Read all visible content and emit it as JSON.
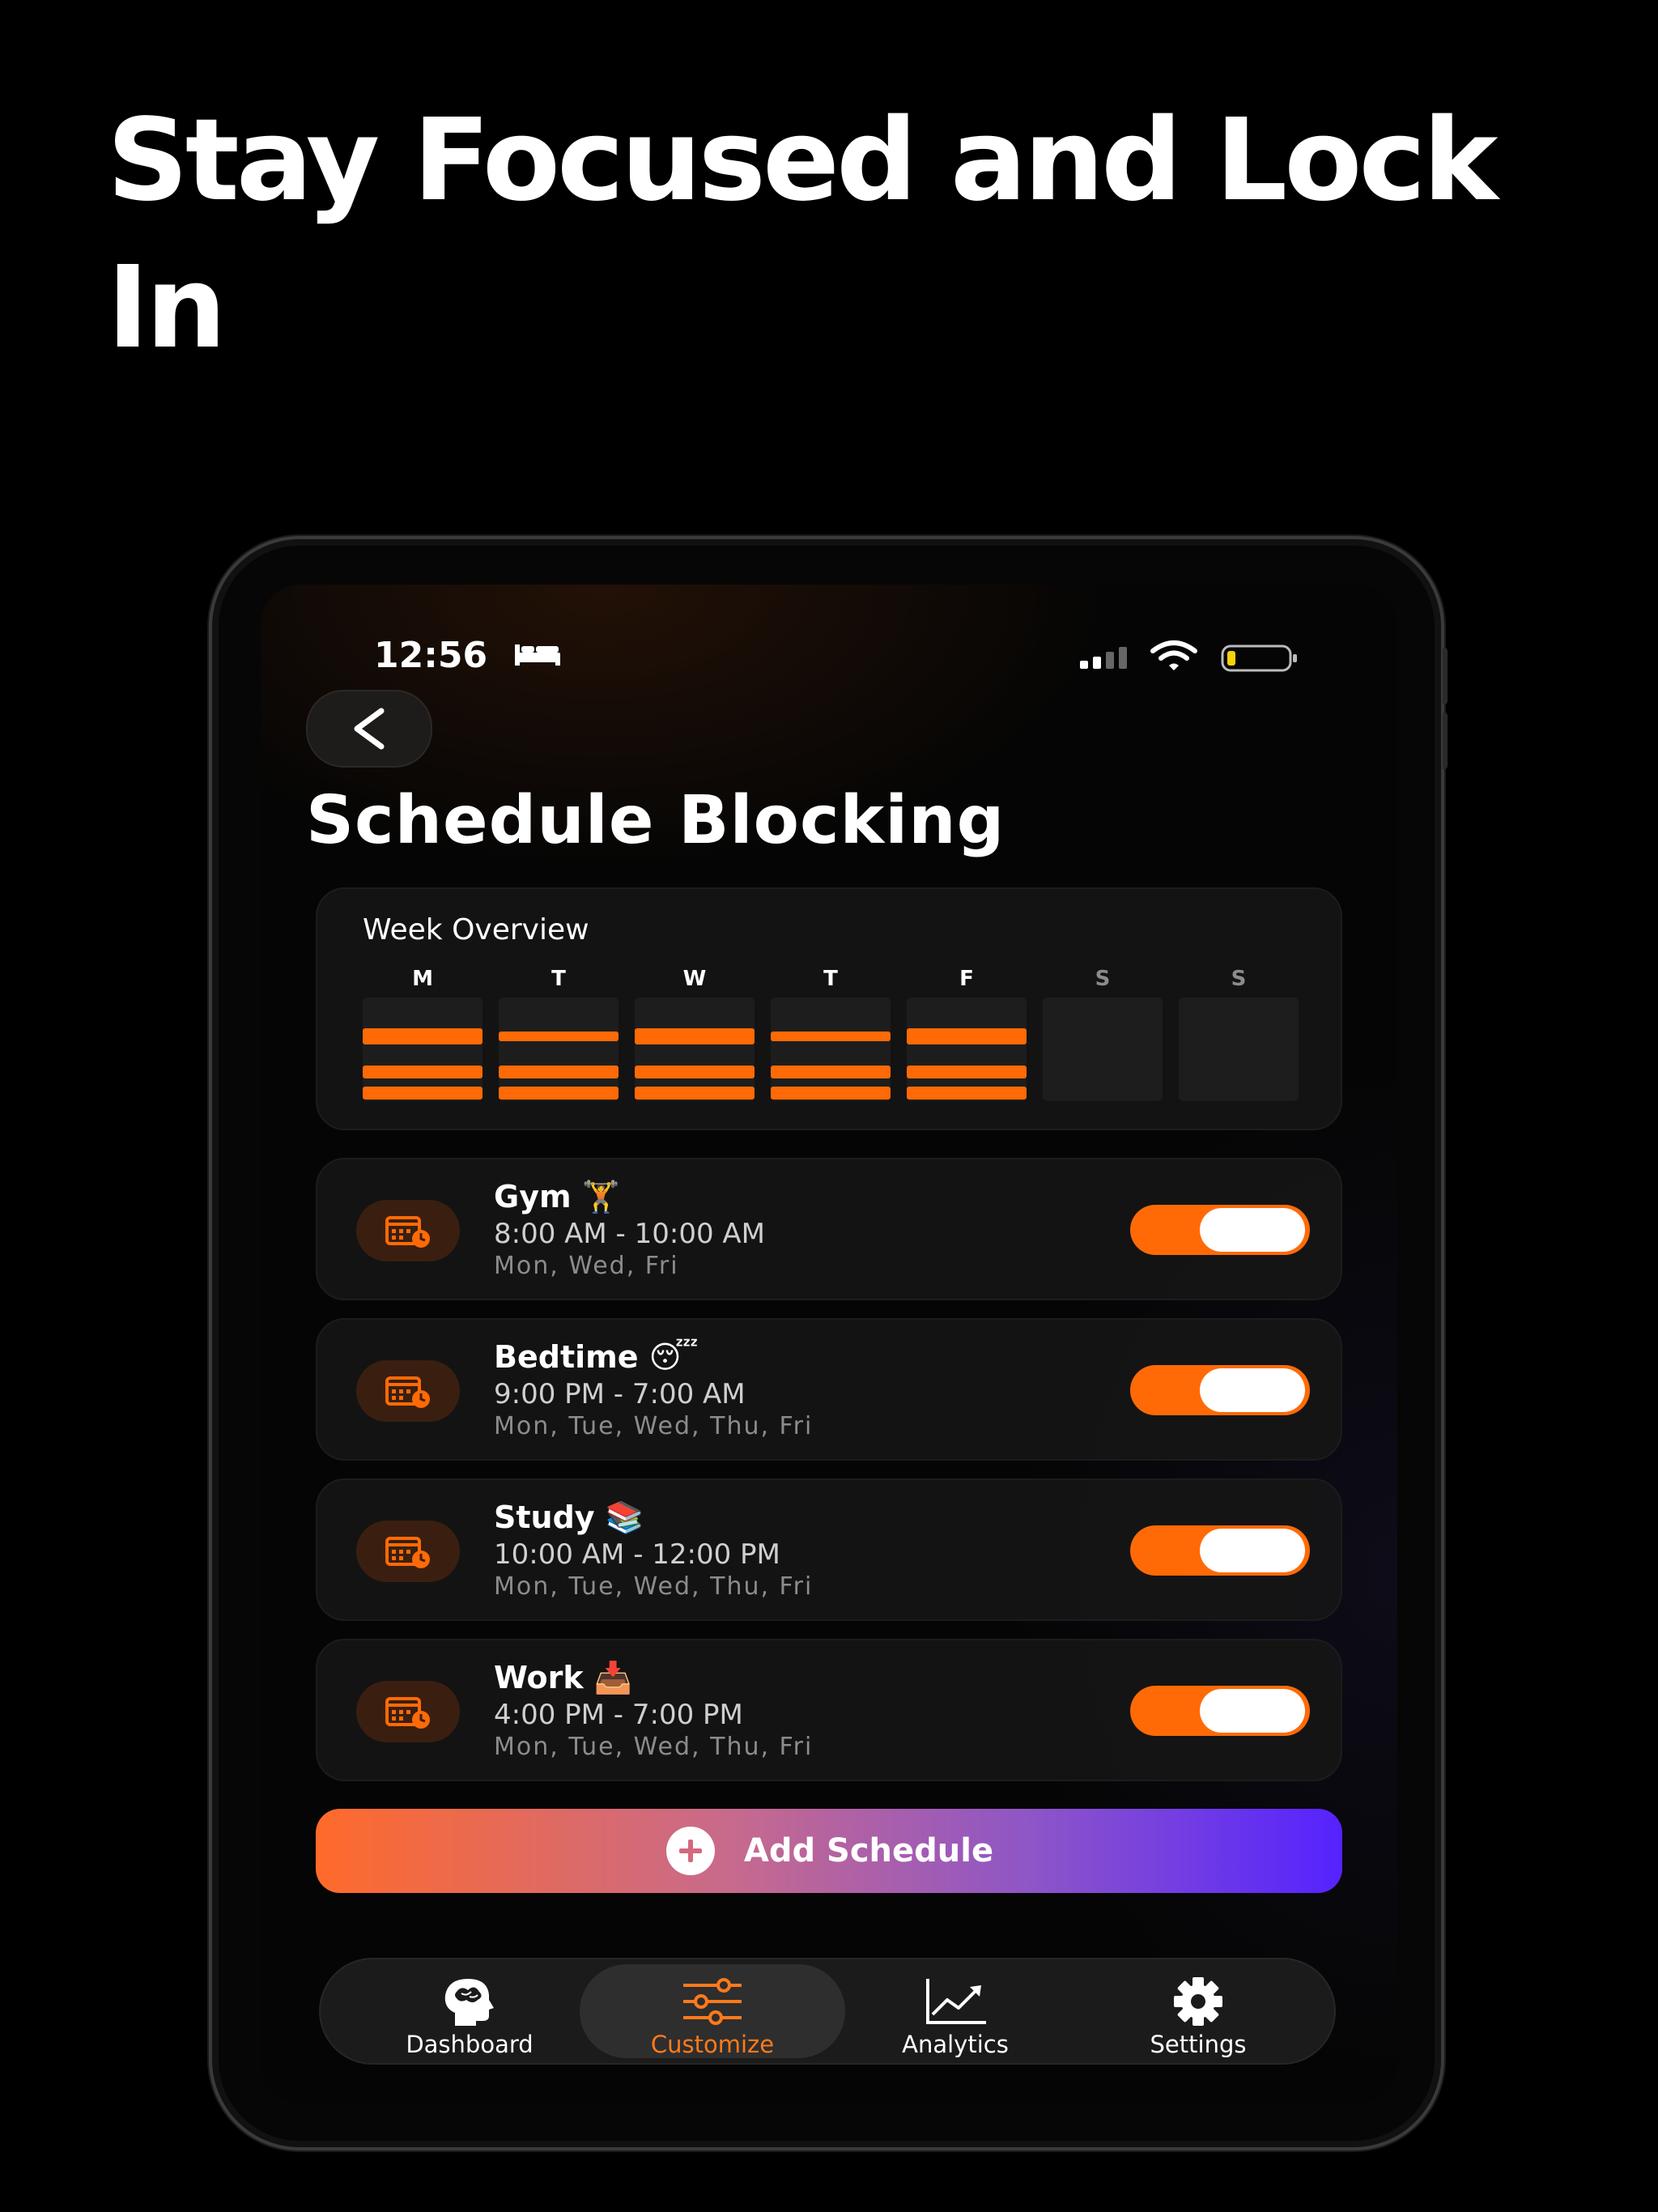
{
  "headline": "Stay Focused and Lock In",
  "status_bar": {
    "time": "12:56"
  },
  "page": {
    "title": "Schedule Blocking"
  },
  "week_overview": {
    "title": "Week Overview",
    "days": [
      {
        "label": "M",
        "blocks": 3
      },
      {
        "label": "T",
        "blocks": 3
      },
      {
        "label": "W",
        "blocks": 3
      },
      {
        "label": "T",
        "blocks": 3
      },
      {
        "label": "F",
        "blocks": 3
      },
      {
        "label": "S",
        "blocks": 0
      },
      {
        "label": "S",
        "blocks": 0
      }
    ]
  },
  "schedules": [
    {
      "name": "Gym 🏋️",
      "time": "8:00 AM - 10:00 AM",
      "days": "Mon, Wed, Fri",
      "enabled": true
    },
    {
      "name": "Bedtime 😴",
      "time": "9:00 PM - 7:00 AM",
      "days": "Mon, Tue, Wed, Thu, Fri",
      "enabled": true
    },
    {
      "name": "Study 📚",
      "time": "10:00 AM - 12:00 PM",
      "days": "Mon, Tue, Wed, Thu, Fri",
      "enabled": true
    },
    {
      "name": "Work 📥",
      "time": "4:00 PM - 7:00 PM",
      "days": "Mon, Tue, Wed, Thu, Fri",
      "enabled": true
    }
  ],
  "add_button": {
    "label": "Add Schedule"
  },
  "tabs": [
    {
      "label": "Dashboard",
      "icon": "brain-head-icon",
      "active": false
    },
    {
      "label": "Customize",
      "icon": "sliders-icon",
      "active": true
    },
    {
      "label": "Analytics",
      "icon": "chart-icon",
      "active": false
    },
    {
      "label": "Settings",
      "icon": "gear-icon",
      "active": false
    }
  ],
  "colors": {
    "accent": "#ff6a06",
    "gradient_start": "#ff6a2a",
    "gradient_end": "#5522ff",
    "inactive_day_label": "#8c8c8c"
  }
}
